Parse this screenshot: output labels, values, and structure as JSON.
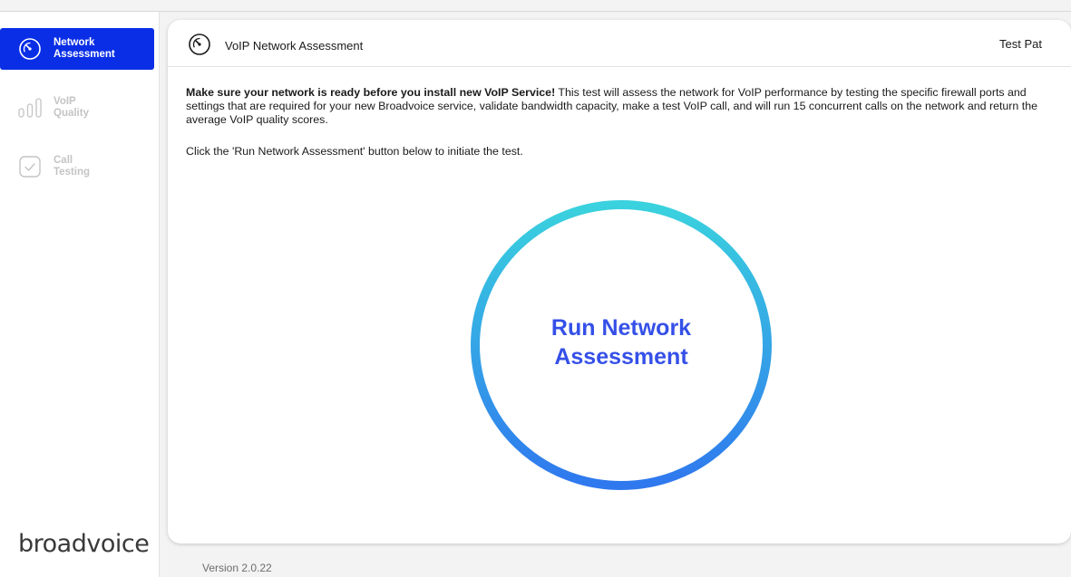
{
  "sidebar": {
    "items": [
      {
        "label": "Network\nAssessment",
        "icon": "speedometer-icon",
        "active": true
      },
      {
        "label": "VoIP\nQuality",
        "icon": "bars-icon",
        "active": false
      },
      {
        "label": "Call\nTesting",
        "icon": "checkbox-icon",
        "active": false
      }
    ],
    "brand": "broadvoice"
  },
  "header": {
    "title": "VoIP Network Assessment",
    "user": "Test Pat"
  },
  "main": {
    "intro_bold": "Make sure your network is ready before you install new VoIP Service!",
    "intro_text": " This test will assess the network for VoIP performance by testing the specific firewall ports and settings that are required for  your new Broadvoice service, validate bandwidth capacity, make a test VoIP call, and will run 15 concurrent calls on the network and return the average VoIP quality scores.",
    "instruction": "Click the 'Run Network Assessment' button below to initiate the test.",
    "run_button_label": "Run Network\nAssessment"
  },
  "footer": {
    "version": "Version 2.0.22"
  },
  "colors": {
    "accent": "#0a2ee6",
    "button_text": "#3550e8",
    "ring_start": "#3ad2de",
    "ring_end": "#2f78ee"
  }
}
